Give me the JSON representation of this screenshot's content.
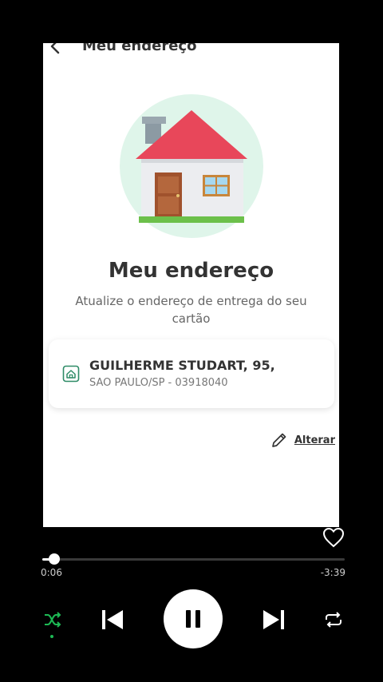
{
  "header": {
    "title": "Meu endereço"
  },
  "main": {
    "title": "Meu endereço",
    "subtitle": "Atualize o endereço de entrega do seu cartão"
  },
  "address": {
    "line1": "GUILHERME STUDART, 95,",
    "line2": "SAO PAULO/SP - 03918040"
  },
  "actions": {
    "edit_label": "Alterar"
  },
  "player": {
    "elapsed": "0:06",
    "remaining": "-3:39",
    "progress": 0.04,
    "shuffle_active": true
  },
  "colors": {
    "accent_green": "#1db954",
    "roof_red": "#e8475a",
    "card_icon_green": "#2e8b67"
  },
  "icons": [
    "back-arrow-icon",
    "home-icon",
    "pencil-icon",
    "heart-icon",
    "shuffle-icon",
    "previous-icon",
    "pause-icon",
    "next-icon",
    "repeat-icon"
  ]
}
